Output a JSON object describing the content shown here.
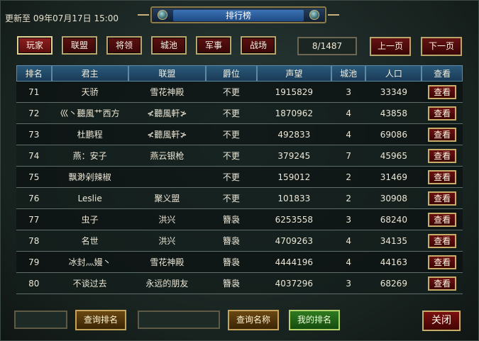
{
  "update": "更新至 09年07月17日 15:00",
  "title": "排行榜",
  "tabs": [
    "玩家",
    "联盟",
    "将领",
    "城池",
    "军事",
    "战场"
  ],
  "page": "8/1487",
  "nav": {
    "prev": "上一页",
    "next": "下一页"
  },
  "columns": [
    "排名",
    "君主",
    "联盟",
    "爵位",
    "声望",
    "城池",
    "人口",
    "查看"
  ],
  "rows": [
    {
      "rank": "71",
      "lord": "天骄",
      "alliance": "雪花神殿",
      "title": "不更",
      "prestige": "1915829",
      "cities": "3",
      "pop": "33349",
      "view": "查看"
    },
    {
      "rank": "72",
      "lord": "巛丶聽風艹西方",
      "alliance": "≮聽風軒≯",
      "title": "不更",
      "prestige": "1870962",
      "cities": "4",
      "pop": "43858",
      "view": "查看"
    },
    {
      "rank": "73",
      "lord": "杜鹏程",
      "alliance": "≮聽風軒≯",
      "title": "不更",
      "prestige": "492833",
      "cities": "4",
      "pop": "69086",
      "view": "查看"
    },
    {
      "rank": "74",
      "lord": "燕：安子",
      "alliance": "燕云银枪",
      "title": "不更",
      "prestige": "379245",
      "cities": "7",
      "pop": "45965",
      "view": "查看"
    },
    {
      "rank": "75",
      "lord": "飘渺剁辣椒",
      "alliance": "",
      "title": "不更",
      "prestige": "159012",
      "cities": "2",
      "pop": "31469",
      "view": "查看"
    },
    {
      "rank": "76",
      "lord": "Leslie",
      "alliance": "聚义盟",
      "title": "不更",
      "prestige": "101833",
      "cities": "2",
      "pop": "30908",
      "view": "查看"
    },
    {
      "rank": "77",
      "lord": "虫子",
      "alliance": "洪兴",
      "title": "簪袅",
      "prestige": "6253558",
      "cities": "3",
      "pop": "68240",
      "view": "查看"
    },
    {
      "rank": "78",
      "lord": "名世",
      "alliance": "洪兴",
      "title": "簪袅",
      "prestige": "4709263",
      "cities": "4",
      "pop": "34135",
      "view": "查看"
    },
    {
      "rank": "79",
      "lord": "冰封灬嫚丶",
      "alliance": "雪花神殿",
      "title": "簪袅",
      "prestige": "4444196",
      "cities": "4",
      "pop": "44163",
      "view": "查看"
    },
    {
      "rank": "80",
      "lord": "不谈过去",
      "alliance": "永远的朋友",
      "title": "簪袅",
      "prestige": "4037296",
      "cities": "3",
      "pop": "68269",
      "view": "查看"
    }
  ],
  "bottom": {
    "query_rank": "查询排名",
    "query_name": "查询名称",
    "my_rank": "我的排名",
    "close": "关闭"
  }
}
